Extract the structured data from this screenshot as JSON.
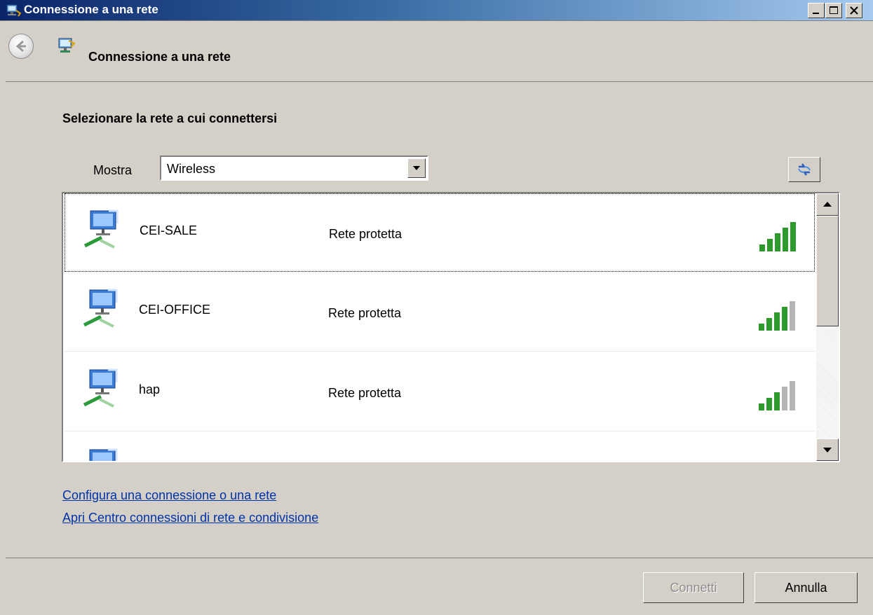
{
  "window": {
    "title": "Connessione a una rete",
    "controls": [
      "minimize",
      "maximize",
      "close"
    ]
  },
  "nav": {
    "title": "Connessione a una rete",
    "back_icon": "back-arrow-icon",
    "page_icon": "network-connect-icon"
  },
  "content": {
    "heading": "Selezionare la rete a cui connettersi",
    "show": {
      "label": "Mostra",
      "selected": "Wireless"
    },
    "refresh_icon": "refresh-icon",
    "networks": [
      {
        "name": "CEI-SALE",
        "status": "Rete protetta",
        "signal_bars": 5,
        "selected": true
      },
      {
        "name": "CEI-OFFICE",
        "status": "Rete protetta",
        "signal_bars": 4,
        "selected": false
      },
      {
        "name": "hap",
        "status": "Rete protetta",
        "signal_bars": 3,
        "selected": false
      },
      {
        "name": "",
        "status": "",
        "signal_bars": 0,
        "selected": false
      }
    ],
    "links": {
      "setup": "Configura una connessione o una rete",
      "network_center": "Apri Centro connessioni di rete e condivisione"
    }
  },
  "buttons": {
    "connect": "Connetti",
    "cancel": "Annulla"
  },
  "colors": {
    "signal_on": "#2c9a2c",
    "signal_off": "#b5b5b5",
    "link": "#0033aa"
  }
}
